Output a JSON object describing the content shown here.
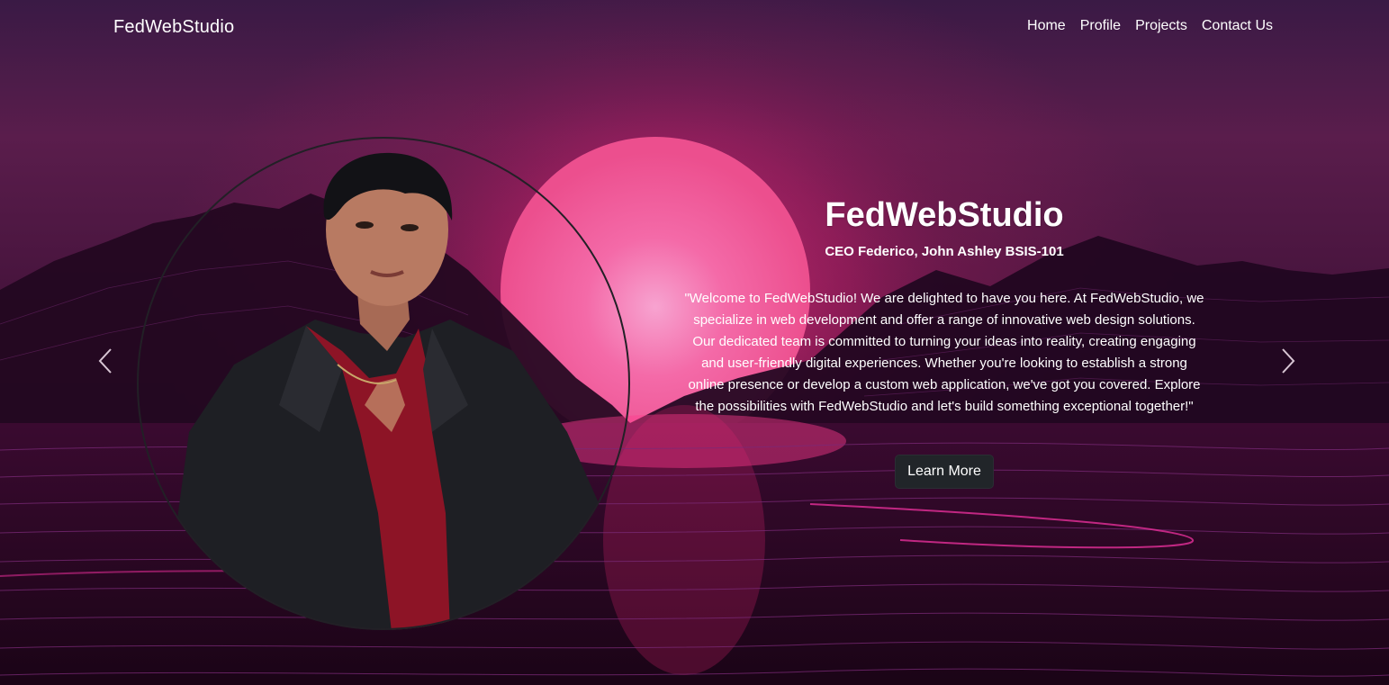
{
  "navbar": {
    "brand": "FedWebStudio",
    "links": [
      "Home",
      "Profile",
      "Projects",
      "Contact Us"
    ]
  },
  "hero": {
    "title": "FedWebStudio",
    "subtitle": "CEO Federico, John Ashley BSIS-101",
    "body": "\"Welcome to FedWebStudio! We are delighted to have you here. At FedWebStudio, we specialize in web development and offer a range of innovative web design solutions. Our dedicated team is committed to turning your ideas into reality, creating engaging and user-friendly digital experiences. Whether you're looking to establish a strong online presence or develop a custom web application, we've got you covered. Explore the possibilities with FedWebStudio and let's build something exceptional together!\"",
    "button_label": "Learn More"
  },
  "carousel": {
    "prev_icon": "chevron-left-icon",
    "next_icon": "chevron-right-icon"
  },
  "colors": {
    "sun": "#f25ea0",
    "button_bg": "#212529",
    "text": "#ffffff"
  }
}
